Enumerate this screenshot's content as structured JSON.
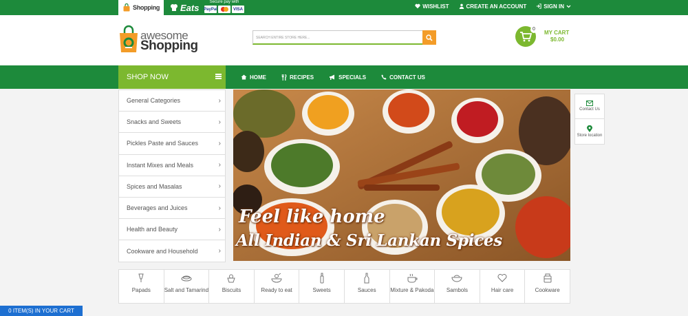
{
  "topbar": {
    "tab_shopping": "Shopping",
    "tab_eats": "Eats",
    "pay_text": "Secure pay with",
    "cards": [
      "PayPal",
      "VISA"
    ],
    "links": [
      {
        "icon": "heart-icon",
        "label": "WISHLIST"
      },
      {
        "icon": "user-icon",
        "label": "CREATE AN ACCOUNT"
      },
      {
        "icon": "signin-icon",
        "label": "SIGN IN"
      }
    ]
  },
  "header": {
    "logo_line1": "awesome",
    "logo_line2": "Shopping",
    "search_placeholder": "SEARCH ENTIRE STORE HERE...",
    "cart_count": "0",
    "cart_label": "MY CART",
    "cart_amount": "$0.00"
  },
  "nav": {
    "shop_now": "SHOP NOW",
    "items": [
      {
        "icon": "home-icon",
        "label": "HOME"
      },
      {
        "icon": "fork-knife-icon",
        "label": "RECIPES"
      },
      {
        "icon": "megaphone-icon",
        "label": "SPECIALS"
      },
      {
        "icon": "phone-icon",
        "label": "CONTACT US"
      }
    ]
  },
  "categories": [
    "General Categories",
    "Snacks and Sweets",
    "Pickles Paste and Sauces",
    "Instant Mixes and Meals",
    "Spices and Masalas",
    "Beverages and Juices",
    "Health and Beauty",
    "Cookware and Household"
  ],
  "banner": {
    "line1": "Feel like home",
    "line2": "All Indian & Sri Lankan Spices"
  },
  "widgets": [
    {
      "icon": "envelope-icon",
      "label": "Contact Us"
    },
    {
      "icon": "location-pin-icon",
      "label": "Store location"
    }
  ],
  "tiles": [
    {
      "icon": "papad-icon",
      "label": "Papads"
    },
    {
      "icon": "salt-icon",
      "label": "Salt and Tamarind"
    },
    {
      "icon": "biscuit-icon",
      "label": "Biscuits"
    },
    {
      "icon": "ready-meal-icon",
      "label": "Ready to eat"
    },
    {
      "icon": "sweets-icon",
      "label": "Sweets"
    },
    {
      "icon": "sauce-bottle-icon",
      "label": "Sauces"
    },
    {
      "icon": "mixture-icon",
      "label": "Mixture & Pakoda"
    },
    {
      "icon": "sambol-bowl-icon",
      "label": "Sambols"
    },
    {
      "icon": "hair-care-icon",
      "label": "Hair care"
    },
    {
      "icon": "cookware-icon",
      "label": "Cookware"
    }
  ],
  "cart_footer": "0 ITEM(S) IN YOUR CART",
  "colors": {
    "green_dark": "#1d8a3b",
    "green_light": "#7cb82f",
    "orange": "#f39c28",
    "blue": "#1d6fd1"
  }
}
